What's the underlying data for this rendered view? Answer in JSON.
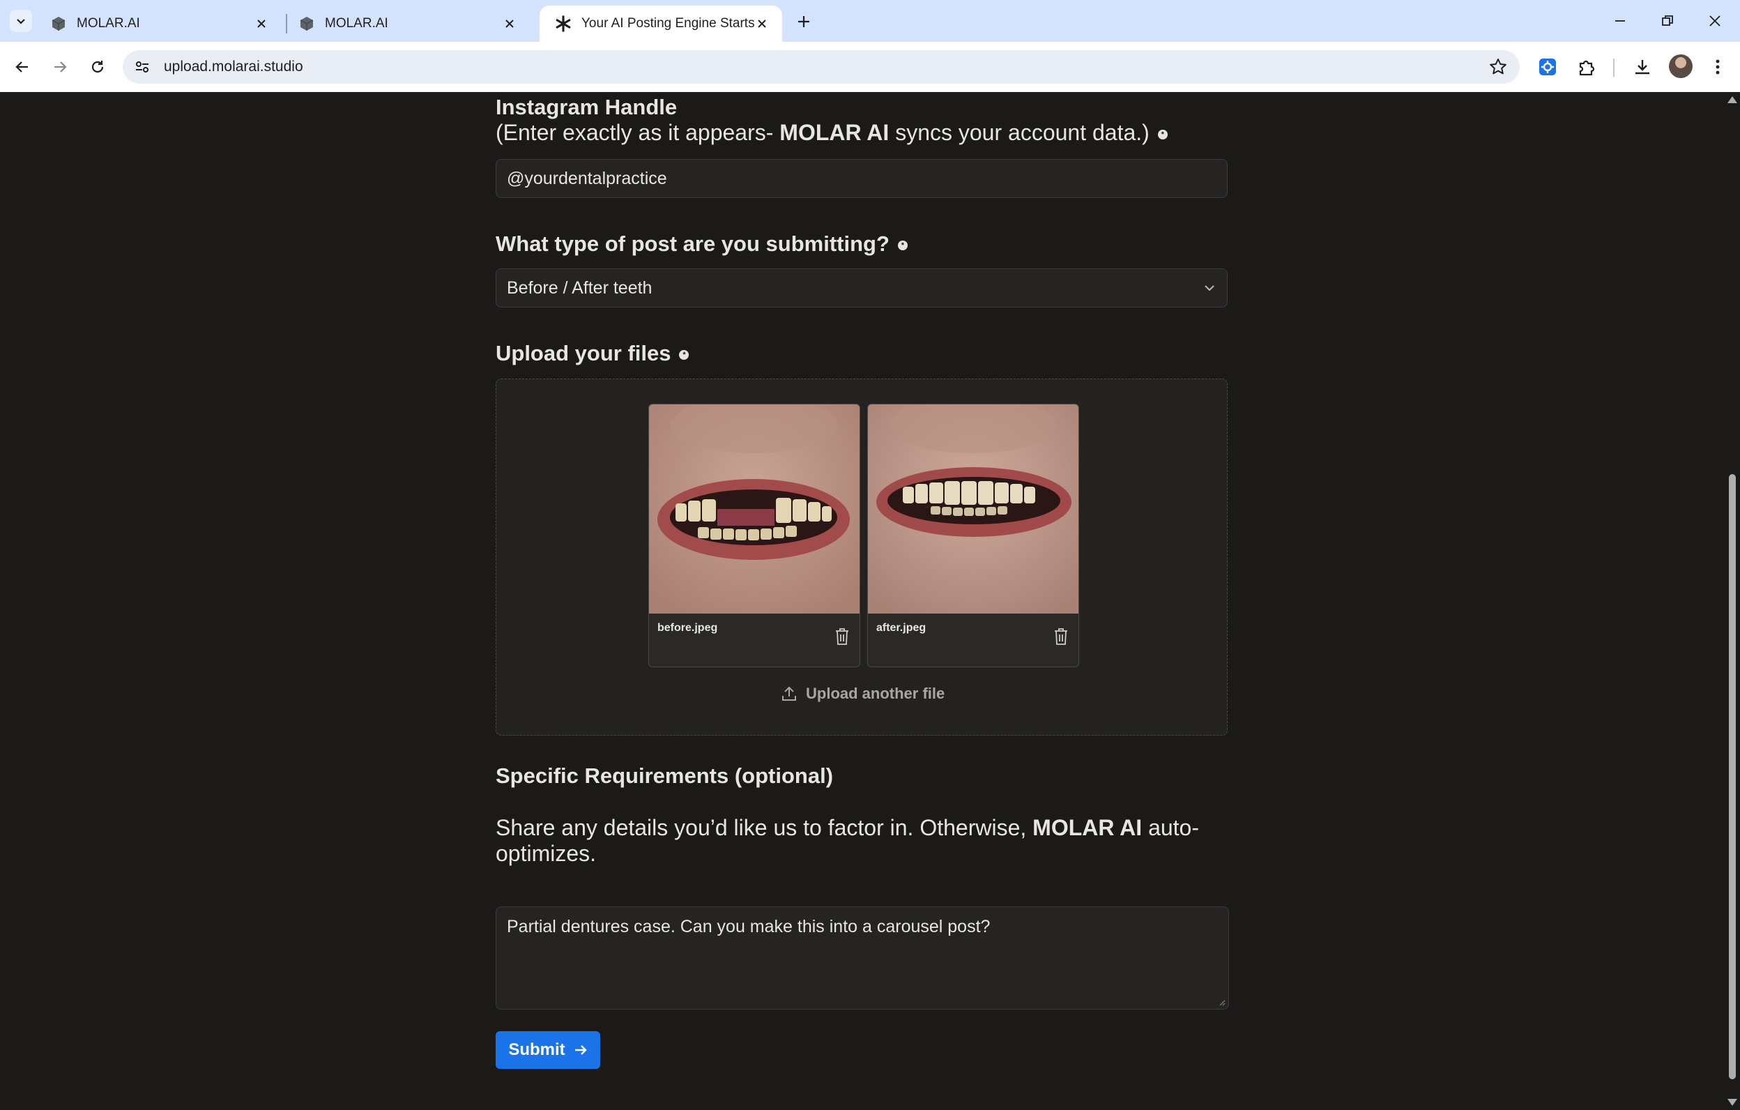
{
  "browser": {
    "tabs": [
      {
        "title": "MOLAR.AI",
        "icon": "cube-icon",
        "active": false
      },
      {
        "title": "MOLAR.AI",
        "icon": "cube-icon",
        "active": false
      },
      {
        "title": "Your AI Posting Engine Starts H",
        "icon": "asterisk-icon",
        "active": true
      }
    ],
    "url": "upload.molarai.studio"
  },
  "form": {
    "instagram": {
      "label": "Instagram Handle",
      "hint_prefix": "(Enter exactly as it appears- ",
      "hint_brand": "MOLAR AI",
      "hint_suffix": " syncs your account data.)",
      "value": "@yourdentalpractice"
    },
    "post_type": {
      "label": "What type of post are you submitting?",
      "value": "Before / After teeth"
    },
    "upload": {
      "label": "Upload your files",
      "files": [
        {
          "name": "before.jpeg"
        },
        {
          "name": "after.jpeg"
        }
      ],
      "upload_another": "Upload another file"
    },
    "requirements": {
      "label": "Specific Requirements (optional)",
      "desc_prefix": "Share any details you’d like us to factor in. Otherwise, ",
      "desc_brand": "MOLAR AI",
      "desc_suffix_1": " auto-",
      "desc_suffix_2": "optimizes.",
      "value": "Partial dentures case. Can you make this into a carousel post?"
    },
    "submit_label": "Submit"
  },
  "required_marker": "*"
}
